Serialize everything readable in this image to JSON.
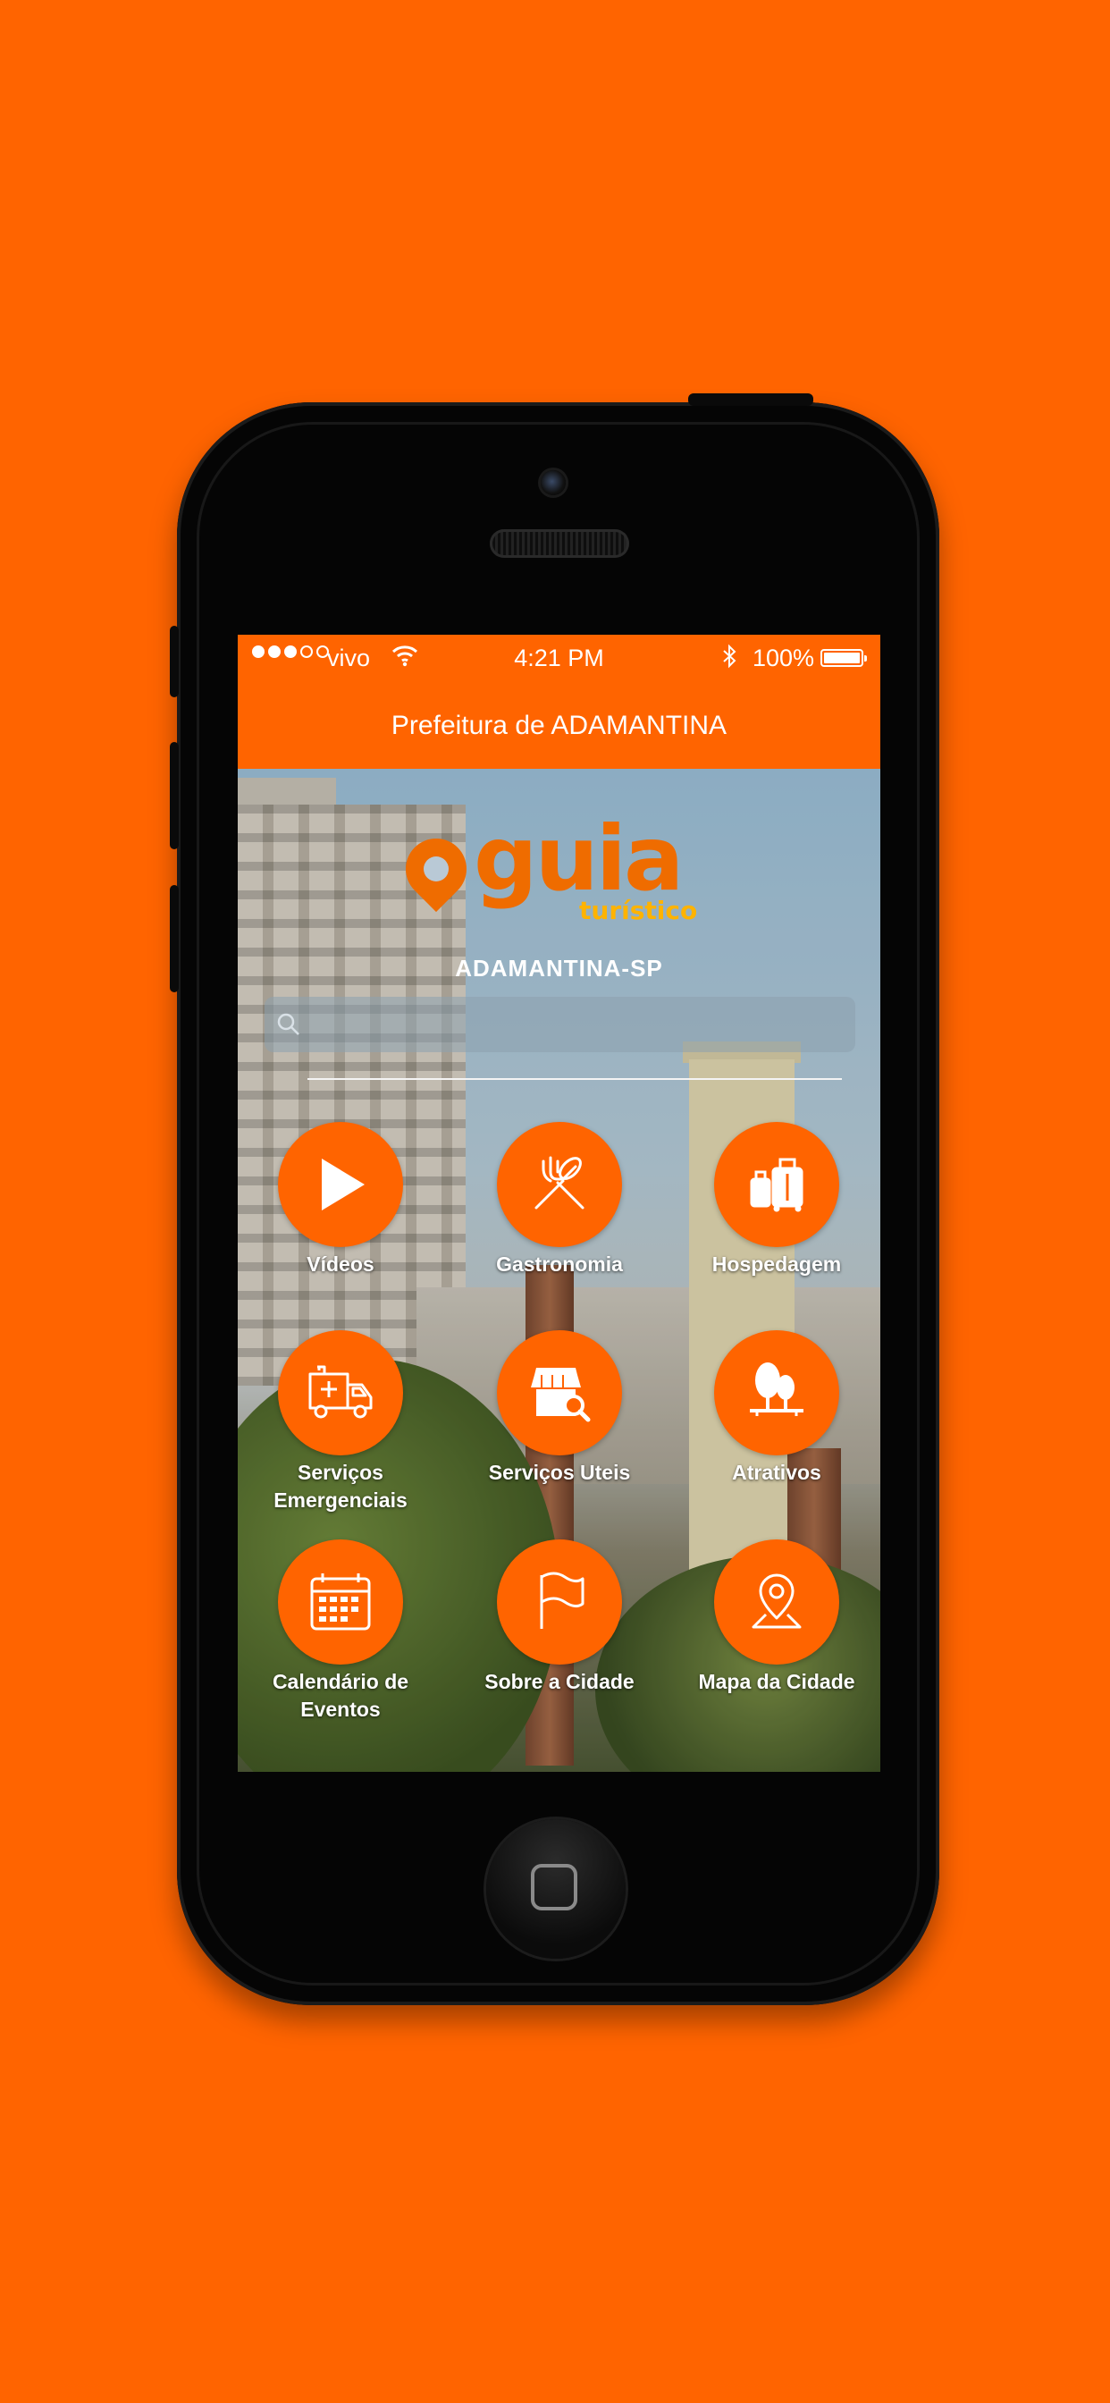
{
  "status_bar": {
    "carrier": "vivo",
    "time": "4:21 PM",
    "battery": "100%",
    "signal_bars_filled": 3,
    "signal_bars_total": 5
  },
  "header": {
    "title": "Prefeitura de ADAMANTINA"
  },
  "logo": {
    "word": "guia",
    "subtitle": "turístico"
  },
  "city_label": "ADAMANTINA-SP",
  "search": {
    "placeholder": "",
    "value": ""
  },
  "menu": [
    {
      "label": "Vídeos",
      "icon": "play-icon"
    },
    {
      "label": "Gastronomia",
      "icon": "fork-spoon-icon"
    },
    {
      "label": "Hospedagem",
      "icon": "luggage-icon"
    },
    {
      "label": "Serviços Emergenciais",
      "icon": "ambulance-icon"
    },
    {
      "label": "Serviços Uteis",
      "icon": "store-search-icon"
    },
    {
      "label": "Atrativos",
      "icon": "park-icon"
    },
    {
      "label": "Calendário de Eventos",
      "icon": "calendar-icon"
    },
    {
      "label": "Sobre a Cidade",
      "icon": "flag-icon"
    },
    {
      "label": "Mapa da Cidade",
      "icon": "map-pin-icon"
    }
  ],
  "colors": {
    "brand": "#ff6400",
    "logo_orange": "#ef6c00",
    "logo_yellow": "#ffb300"
  }
}
